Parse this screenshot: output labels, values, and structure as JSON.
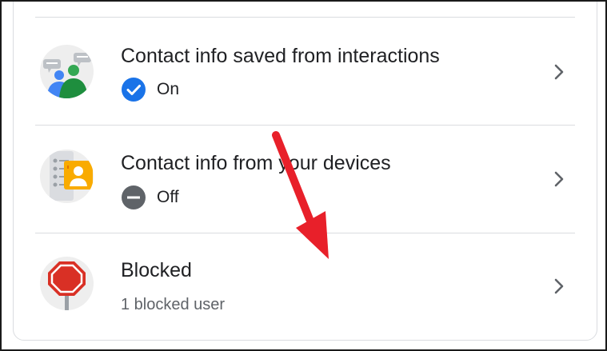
{
  "settings": {
    "items": [
      {
        "title": "Contact info saved from interactions",
        "status": "On",
        "status_icon": "check-circle-icon",
        "icon": "people-chat-icon"
      },
      {
        "title": "Contact info from your devices",
        "status": "Off",
        "status_icon": "minus-circle-icon",
        "icon": "device-contact-icon"
      },
      {
        "title": "Blocked",
        "subtitle": "1 blocked user",
        "icon": "stop-sign-icon"
      }
    ]
  },
  "colors": {
    "accent_blue": "#1a73e8",
    "off_gray": "#5f6368",
    "text_primary": "#202124",
    "divider": "#dadce0",
    "annotation_arrow": "#e8202a",
    "stop_red": "#d93025",
    "contact_yellow": "#f9ab00",
    "people_green": "#1e8e3e"
  }
}
